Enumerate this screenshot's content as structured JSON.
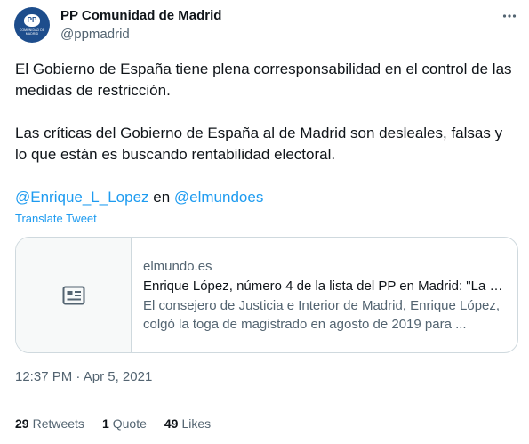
{
  "author": {
    "display_name": "PP Comunidad de Madrid",
    "handle": "@ppmadrid",
    "avatar_mark": "PP",
    "avatar_subtext": "COMUNIDAD DE MADRID"
  },
  "tweet": {
    "paragraph1": "El Gobierno de España tiene plena corresponsabilidad en el control de las medidas de restricción.",
    "paragraph2": "Las críticas del Gobierno de España al de Madrid son desleales, falsas y lo que están es buscando rentabilidad electoral.",
    "mention1": "@Enrique_L_Lopez",
    "connector": " en ",
    "mention2": "@elmundoes",
    "translate_label": "Translate Tweet"
  },
  "card": {
    "domain": "elmundo.es",
    "title": "Enrique López, número 4 de la lista del PP en Madrid: \"La c...",
    "description": "El consejero de Justicia e Interior de Madrid, Enrique López, colgó la toga de magistrado en agosto de 2019 para ...",
    "thumb_icon": "article-icon"
  },
  "meta": {
    "time": "12:37 PM",
    "separator": " · ",
    "date": "Apr 5, 2021"
  },
  "stats": {
    "retweets_count": "29",
    "retweets_label": "Retweets",
    "quotes_count": "1",
    "quotes_label": "Quote",
    "likes_count": "49",
    "likes_label": "Likes"
  },
  "colors": {
    "accent": "#1d9bf0",
    "secondary_text": "#536471",
    "avatar_bg": "#1d4d8c"
  },
  "icons": {
    "more": "more-horizontal-icon"
  }
}
